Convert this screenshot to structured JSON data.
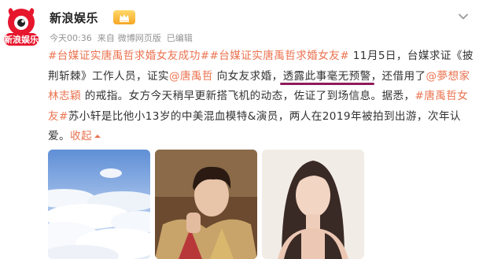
{
  "account": {
    "name": "新浪娱乐",
    "avatar_label": "新浪娱乐",
    "verified": true
  },
  "meta": {
    "time": "今天00:36",
    "source": "来自",
    "client": "微博网页版",
    "edited": "已编辑"
  },
  "post": {
    "hashtag_1": "#台媒证实唐禹哲求婚女友成功#",
    "hashtag_2": "#台媒证实唐禹哲求婚女友#",
    "text_1": " 11月5日，台媒求证《披荆斩棘》工作人员，证实",
    "mention_1": "@唐禹哲",
    "text_2": " 向女友求婚，",
    "highlight": "透露此事毫无预警",
    "text_3": "，还借用了",
    "mention_2": "@夢想家林志穎",
    "text_4": " 的戒指。女方今天稍早更新搭飞机的动态，佐证了到场信息。据悉，",
    "hashtag_3": "#唐禹哲女友#",
    "text_5": "苏小轩是比他小13岁的中美混血模特&演员，两人在2019年被拍到出游，次年认爱。",
    "collapse_label": "收起",
    "collapse_icon": "caret-up-icon"
  },
  "images": [
    {
      "name": "clouds-photo"
    },
    {
      "name": "man-portrait-photo"
    },
    {
      "name": "woman-portrait-photo"
    }
  ],
  "colors": {
    "link": "#eb7350",
    "highlight_underline": "#8e1b5a",
    "meta_text": "#939393",
    "avatar_red": "#e6162d",
    "badge_gold": "#f6a623"
  }
}
